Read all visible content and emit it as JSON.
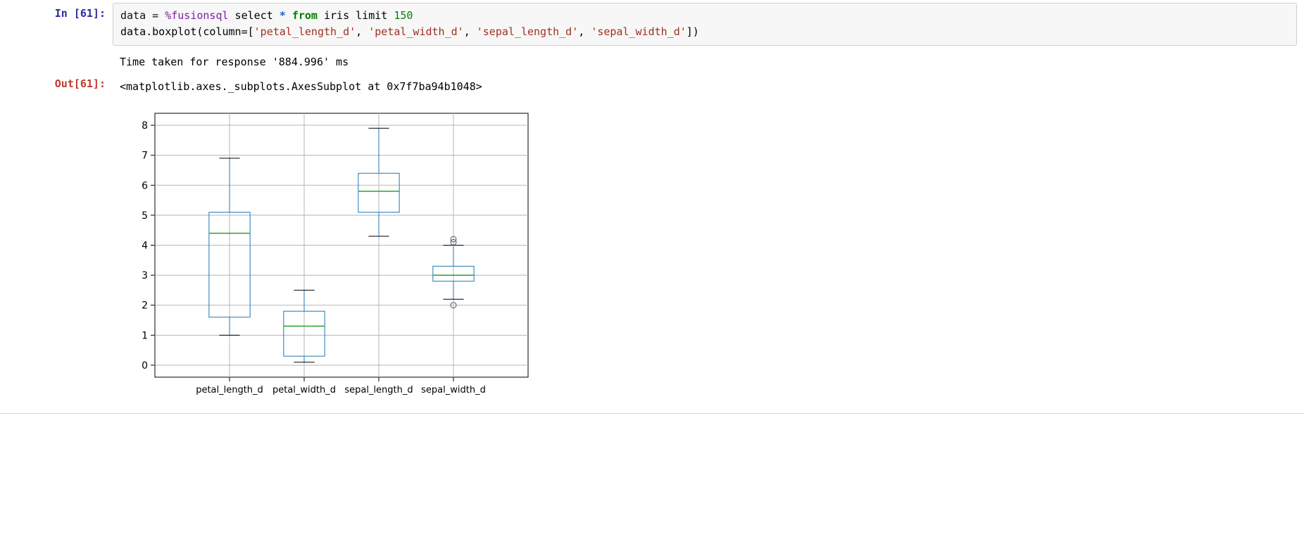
{
  "cell": {
    "in_prompt": "In [61]:",
    "out_prompt": "Out[61]:",
    "code": {
      "l1": {
        "p1": "data ",
        "eq": "=",
        "sp1": " ",
        "magic": "%fusionsql",
        "sp2": " select ",
        "star": "*",
        "sp3": " ",
        "from": "from",
        "sp4": " iris limit ",
        "n150": "150"
      },
      "l2": {
        "p1": "data.boxplot(column=[",
        "s1": "'petal_length_d'",
        "c1": ", ",
        "s2": "'petal_width_d'",
        "c2": ", ",
        "s3": "'sepal_length_d'",
        "c3": ", ",
        "s4": "'sepal_width_d'",
        "end": "])"
      }
    },
    "stdout": "Time taken for response '884.996' ms",
    "result": "<matplotlib.axes._subplots.AxesSubplot at 0x7f7ba94b1048>"
  },
  "chart_data": {
    "type": "boxplot",
    "categories": [
      "petal_length_d",
      "petal_width_d",
      "sepal_length_d",
      "sepal_width_d"
    ],
    "yticks": [
      0,
      1,
      2,
      3,
      4,
      5,
      6,
      7,
      8
    ],
    "ylim": [
      -0.4,
      8.4
    ],
    "series": [
      {
        "name": "petal_length_d",
        "whisker_low": 1.0,
        "q1": 1.6,
        "median": 4.4,
        "q3": 5.1,
        "whisker_high": 6.9,
        "fliers": []
      },
      {
        "name": "petal_width_d",
        "whisker_low": 0.1,
        "q1": 0.3,
        "median": 1.3,
        "q3": 1.8,
        "whisker_high": 2.5,
        "fliers": []
      },
      {
        "name": "sepal_length_d",
        "whisker_low": 4.3,
        "q1": 5.1,
        "median": 5.8,
        "q3": 6.4,
        "whisker_high": 7.9,
        "fliers": []
      },
      {
        "name": "sepal_width_d",
        "whisker_low": 2.2,
        "q1": 2.8,
        "median": 3.0,
        "q3": 3.3,
        "whisker_high": 4.0,
        "fliers": [
          4.1,
          4.2,
          2.0
        ]
      }
    ]
  }
}
